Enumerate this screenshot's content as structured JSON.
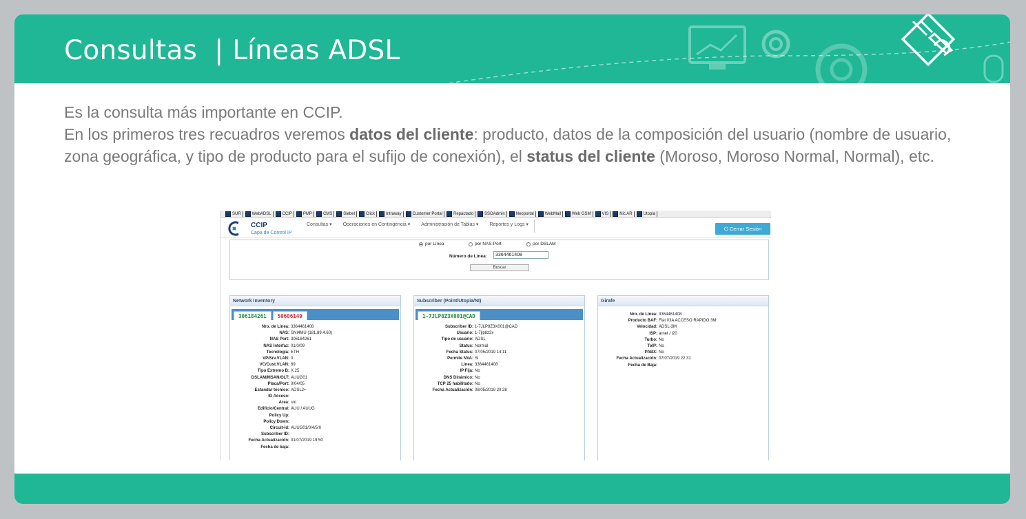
{
  "slide": {
    "title": "Consultas  | Líneas ADSL",
    "intro_line1": "Es la consulta más importante en CCIP.",
    "intro_p2_a": "En los primeros tres recuadros veremos ",
    "intro_p2_b": "datos del cliente",
    "intro_p2_c": ": producto, datos de la composición del usuario (nombre de usuario, zona geográfica, y tipo de producto para el sufijo de conexión), el ",
    "intro_p2_d": "status del cliente",
    "intro_p2_e": " (Moroso, Moroso Normal, Normal), etc."
  },
  "toolbar": {
    "items": [
      "SUR",
      "WebADSL",
      "CCIP",
      "PMP",
      "CMS",
      "Siebel",
      "Click",
      "Intraway",
      "Customer Portal",
      "Repactado",
      "SSOAdmin",
      "Neoportal",
      "WebMail",
      "Web GSM",
      "VIS",
      "Nic AR",
      "Utopia"
    ]
  },
  "app": {
    "name": "CCIP",
    "subtitle": "Capa de Control IP",
    "menu": [
      "Consultas ▾",
      "Operaciones en Contingencia ▾",
      "Administración de Tablas ▾",
      "Reportes y Logs ▾"
    ],
    "logout_label": "⏻ Cerrar Sesión"
  },
  "search": {
    "radio_linea": "por Línea",
    "radio_nasport": "por NAS-Port",
    "radio_dslam": "por DSLAM",
    "selected": "por Línea",
    "line_label": "Número de Línea:",
    "line_value": "3364461408",
    "button_label": "Buscar"
  },
  "network_inventory": {
    "title": "Network Inventory",
    "tabs": [
      "306184261",
      "50606149"
    ],
    "rows": [
      {
        "k": "Nro. de Línea:",
        "v": "3364461408"
      },
      {
        "k": "NAS:",
        "v": "SNI4MU (181.89.4.60)"
      },
      {
        "k": "NAS Port:",
        "v": "306184261"
      },
      {
        "k": "NAS Interfaz:",
        "v": "01/0/09"
      },
      {
        "k": "Tecnologia:",
        "v": "ETH"
      },
      {
        "k": "VP/Srv.VLAN:",
        "v": "0"
      },
      {
        "k": "VC/Cust.VLAN:",
        "v": "69"
      },
      {
        "k": "Tipo Extremo B:",
        "v": "X.25"
      },
      {
        "k": "DSLAM/MSAN/OLT:",
        "v": "AUUG01"
      },
      {
        "k": "Placa/Port:",
        "v": "0/04/05"
      },
      {
        "k": "Estandar técnico:",
        "v": "ADSL2+"
      },
      {
        "k": "ID Acceso:",
        "v": ""
      },
      {
        "k": "Area:",
        "v": "sni"
      },
      {
        "k": "Edificio/Central:",
        "v": "AUU / AUUG"
      },
      {
        "k": "Policy Up:",
        "v": ""
      },
      {
        "k": "Policy Down:",
        "v": ""
      },
      {
        "k": "Circuit-Id:",
        "v": "AUUG01/0/4/5/0"
      },
      {
        "k": "Subscriber ID:",
        "v": ""
      },
      {
        "k": "Fecha Actualización:",
        "v": "01/07/2019 19:50"
      },
      {
        "k": "Fecha de baja:",
        "v": ""
      }
    ]
  },
  "subscriber": {
    "title": "Subscriber (Point/Utopia/NI)",
    "tabs": [
      "1-7JLP8Z3X001@CAD"
    ],
    "rows": [
      {
        "k": "Subscriber ID:",
        "v": "1-7JLP8Z3X001@CAD"
      },
      {
        "k": "Usuario:",
        "v": "1-7jlp8z3x"
      },
      {
        "k": "Tipo de usuario:",
        "v": "ADSL"
      },
      {
        "k": "Status:",
        "v": "Normal"
      },
      {
        "k": "Fecha Status:",
        "v": "07/05/2019 14:11"
      },
      {
        "k": "Permite NVA:",
        "v": "Si"
      },
      {
        "k": "Linea:",
        "v": "3364461408"
      },
      {
        "k": "IP Fija:",
        "v": "No"
      },
      {
        "k": "DNS Dinámico:",
        "v": "No"
      },
      {
        "k": "TCP 25 habilitado:",
        "v": "No"
      },
      {
        "k": "Fecha Actualización:",
        "v": "08/05/2019 20:28"
      }
    ]
  },
  "girafe": {
    "title": "Girafe",
    "rows": [
      {
        "k": "Nro. de Línea:",
        "v": "3364461408"
      },
      {
        "k": "Producto BAF:",
        "v": "Flat 03A ACCESO RAPIDO 3M"
      },
      {
        "k": "Velocidad:",
        "v": "ADSL-3M"
      },
      {
        "k": "ISP:",
        "v": "arnet / l20"
      },
      {
        "k": "Turbo:",
        "v": "No"
      },
      {
        "k": "ToIP:",
        "v": "No"
      },
      {
        "k": "PABX:",
        "v": "No"
      },
      {
        "k": "Fecha Actualización:",
        "v": "07/07/2019 22:31"
      },
      {
        "k": "Fecha de Baja:",
        "v": ""
      }
    ]
  }
}
